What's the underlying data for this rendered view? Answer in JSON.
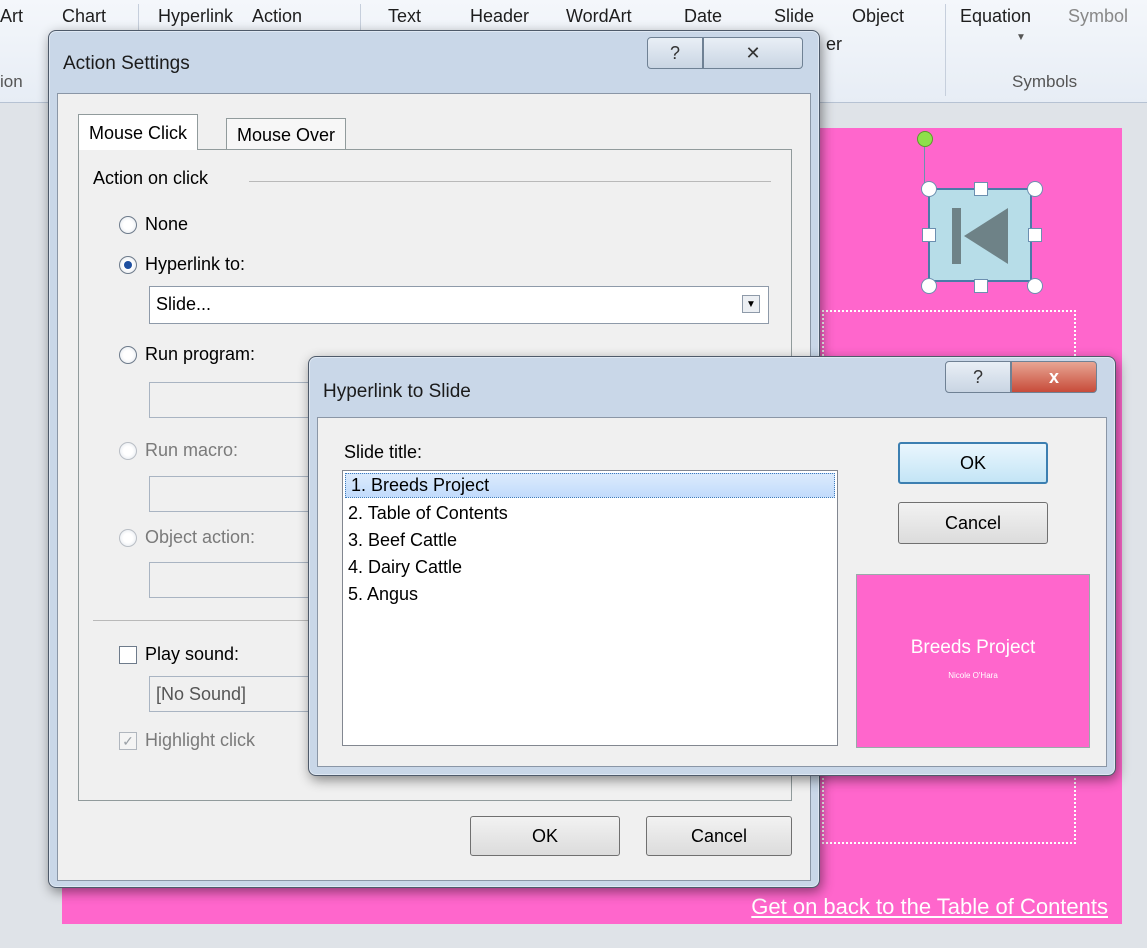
{
  "ribbon": {
    "items": [
      "Art",
      "Chart",
      "Hyperlink",
      "Action",
      "Text",
      "Header",
      "WordArt",
      "Date",
      "Slide",
      "Object",
      "Equation",
      "Symbol"
    ],
    "partial_labels": [
      "er"
    ],
    "left_group_fragment": "ion",
    "groups": {
      "symbols": "Symbols"
    }
  },
  "slide": {
    "link_text": "Get on back to the Table of Contents",
    "background": "#ff66cc"
  },
  "action_settings": {
    "title": "Action Settings",
    "help": "?",
    "close": "✕",
    "tabs": [
      "Mouse Click",
      "Mouse Over"
    ],
    "group_label": "Action on click",
    "options": {
      "none": "None",
      "hyperlink": "Hyperlink to:",
      "run_program": "Run program:",
      "run_macro": "Run macro:",
      "object_action": "Object action:"
    },
    "hyperlink_value": "Slide...",
    "play_sound": "Play sound:",
    "sound_value": "[No Sound]",
    "highlight_click": "Highlight click",
    "ok": "OK",
    "cancel": "Cancel"
  },
  "hyperlink_dialog": {
    "title": "Hyperlink to Slide",
    "help": "?",
    "close": "x",
    "list_label": "Slide title:",
    "slides": [
      "1. Breeds Project",
      "2. Table of Contents",
      "3. Beef Cattle",
      "4. Dairy Cattle",
      "5. Angus"
    ],
    "selected_index": 0,
    "ok": "OK",
    "cancel": "Cancel",
    "preview": {
      "title": "Breeds Project",
      "subtitle": "Nicole O'Hara"
    }
  },
  "colors": {
    "accent": "#3c7fb1",
    "close_red": "#c74b3a",
    "slide": "#ff66cc"
  }
}
